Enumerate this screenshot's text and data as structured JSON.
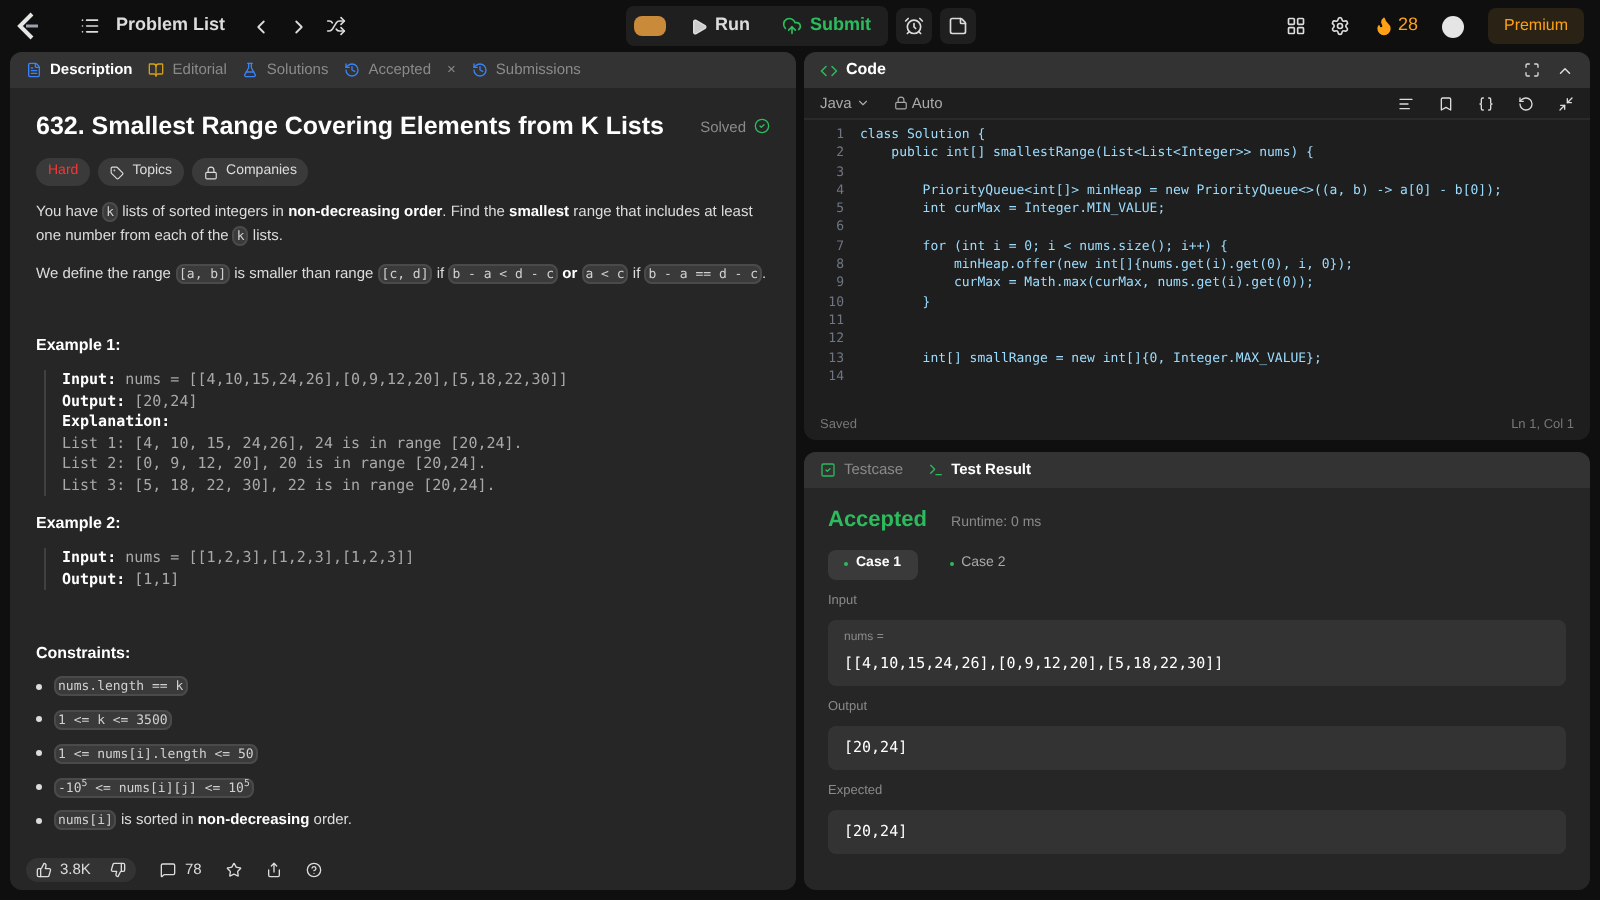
{
  "nav": {
    "problem_list": "Problem List",
    "run": "Run",
    "submit": "Submit",
    "streak": "28",
    "premium": "Premium"
  },
  "left_tabs": [
    {
      "label": "Description",
      "selected": true
    },
    {
      "label": "Editorial",
      "selected": false
    },
    {
      "label": "Solutions",
      "selected": false
    },
    {
      "label": "Accepted",
      "selected": false,
      "close": "×"
    },
    {
      "label": "Submissions",
      "selected": false
    }
  ],
  "problem": {
    "title": "632. Smallest Range Covering Elements from K Lists",
    "status": "Solved",
    "difficulty": "Hard",
    "tags": [
      "Topics",
      "Companies"
    ],
    "paragraphs": [
      [
        {
          "kind": "text",
          "text": "You have "
        },
        {
          "kind": "code",
          "text": "k"
        },
        {
          "kind": "text",
          "text": " lists of sorted integers in "
        },
        {
          "kind": "bold",
          "text": "non-decreasing order"
        },
        {
          "kind": "text",
          "text": ". Find the "
        },
        {
          "kind": "bold",
          "text": "smallest"
        },
        {
          "kind": "text",
          "text": " range that includes at least one number from each of the "
        },
        {
          "kind": "code",
          "text": "k"
        },
        {
          "kind": "text",
          "text": " lists."
        }
      ],
      [
        {
          "kind": "text",
          "text": "We define the range "
        },
        {
          "kind": "code",
          "text": "[a, b]"
        },
        {
          "kind": "text",
          "text": " is smaller than range "
        },
        {
          "kind": "code",
          "text": "[c, d]"
        },
        {
          "kind": "text",
          "text": " if "
        },
        {
          "kind": "code",
          "text": "b - a < d - c"
        },
        {
          "kind": "bold",
          "text": " or "
        },
        {
          "kind": "code",
          "text": "a < c"
        },
        {
          "kind": "text",
          "text": " if "
        },
        {
          "kind": "code",
          "text": "b - a == d - c"
        },
        {
          "kind": "text",
          "text": "."
        }
      ]
    ],
    "examples": [
      {
        "title": "Example 1:",
        "lines": [
          {
            "kind": "field",
            "label": "Input:",
            "text": "nums = [[4,10,15,24,26],[0,9,12,20],[5,18,22,30]]"
          },
          {
            "kind": "field",
            "label": "Output:",
            "text": "[20,24]"
          },
          {
            "kind": "heading",
            "label": "Explanation:"
          },
          {
            "kind": "plain",
            "text": "List 1: [4, 10, 15, 24,26], 24 is in range [20,24]."
          },
          {
            "kind": "plain",
            "text": "List 2: [0, 9, 12, 20], 20 is in range [20,24]."
          },
          {
            "kind": "plain",
            "text": "List 3: [5, 18, 22, 30], 22 is in range [20,24]."
          }
        ]
      },
      {
        "title": "Example 2:",
        "lines": [
          {
            "kind": "field",
            "label": "Input:",
            "text": "nums = [[1,2,3],[1,2,3],[1,2,3]]"
          },
          {
            "kind": "field",
            "label": "Output:",
            "text": "[1,1]"
          }
        ]
      }
    ],
    "constraints_title": "Constraints:",
    "constraints": [
      [
        {
          "kind": "code",
          "text": "nums.length == k"
        }
      ],
      [
        {
          "kind": "code",
          "text": "1 <= k <= 3500"
        }
      ],
      [
        {
          "kind": "code",
          "text": "1 <= nums[i].length <= 50"
        }
      ],
      [
        {
          "kind": "code",
          "text": "-10$^{5}$ <= nums[i][j] <= 10$^{5}$"
        }
      ],
      [
        {
          "kind": "code",
          "text": "nums[i]"
        },
        {
          "kind": "text",
          "text": " is sorted in "
        },
        {
          "kind": "bold",
          "text": "non-decreasing"
        },
        {
          "kind": "text",
          "text": " order."
        }
      ]
    ],
    "likes": "3.8K",
    "comments": "78"
  },
  "code_panel": {
    "title": "Code",
    "language": "Java",
    "mode": "Auto",
    "status": "Saved",
    "cursor": "Ln 1, Col 1",
    "lines": [
      {
        "number": "1",
        "text": "class Solution {"
      },
      {
        "number": "2",
        "text": "    public int[] smallestRange(List<List<Integer>> nums) {"
      },
      {
        "number": "3"
      },
      {
        "number": "4",
        "text": "        PriorityQueue<int[]> minHeap = new PriorityQueue<>((a, b) -> a[0] - b[0]);"
      },
      {
        "number": "5",
        "text": "        int curMax = Integer.MIN_VALUE;"
      },
      {
        "number": "6"
      },
      {
        "number": "7",
        "text": "        for (int i = 0; i < nums.size(); i++) {"
      },
      {
        "number": "8",
        "text": "            minHeap.offer(new int[]{nums.get(i).get(0), i, 0});"
      },
      {
        "number": "9",
        "text": "            curMax = Math.max(curMax, nums.get(i).get(0));"
      },
      {
        "number": "10",
        "text": "        }"
      },
      {
        "number": "11"
      },
      {
        "number": "12"
      },
      {
        "number": "13",
        "text": "        int[] smallRange = new int[]{0, Integer.MAX_VALUE};"
      },
      {
        "number": "14"
      }
    ]
  },
  "result_panel": {
    "tabs": [
      {
        "label": "Testcase",
        "selected": false
      },
      {
        "label": "Test Result",
        "selected": true
      }
    ],
    "verdict": "Accepted",
    "runtime": "Runtime: 0 ms",
    "cases": [
      {
        "label": "Case 1",
        "selected": true
      },
      {
        "label": "Case 2",
        "selected": false
      }
    ],
    "sections": [
      {
        "label": "Input",
        "variable": "nums =",
        "value": "[[4,10,15,24,26],[0,9,12,20],[5,18,22,30]]"
      },
      {
        "label": "Output",
        "value": "[20,24]"
      },
      {
        "label": "Expected",
        "value": "[20,24]"
      }
    ]
  }
}
